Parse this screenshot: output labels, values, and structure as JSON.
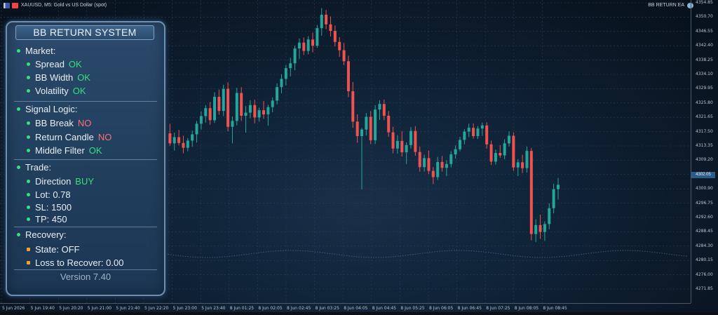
{
  "window": {
    "title": "XAUUSD, M5:  Gold vs US Dollar (spot)",
    "ea_name": "BB RETURN EA"
  },
  "panel": {
    "title": "BB RETURN SYSTEM",
    "market": {
      "label": "Market:",
      "spread_label": "Spread",
      "spread_value": "OK",
      "bbwidth_label": "BB Width",
      "bbwidth_value": "OK",
      "volatility_label": "Volatility",
      "volatility_value": "OK"
    },
    "signal": {
      "label": "Signal Logic:",
      "bbbreak_label": "BB Break",
      "bbbreak_value": "NO",
      "returncandle_label": "Return Candle",
      "returncandle_value": "NO",
      "middlefilter_label": "Middle Filter",
      "middlefilter_value": "OK"
    },
    "trade": {
      "label": "Trade:",
      "direction_label": "Direction",
      "direction_value": "BUY",
      "lot_label": "Lot:",
      "lot_value": "0.78",
      "sl_label": "SL:",
      "sl_value": "1500",
      "tp_label": "TP:",
      "tp_value": "450"
    },
    "recovery": {
      "label": "Recovery:",
      "state_label": "State:",
      "state_value": "OFF",
      "loss_label": "Loss to Recover:",
      "loss_value": "0.00"
    },
    "version": "Version 7.40"
  },
  "colors": {
    "bull": "#26a69a",
    "bear": "#ef5350",
    "ok": "#36e07a",
    "no": "#ff6f6f",
    "accent": "#2c5d86"
  },
  "chart_data": {
    "type": "candlestick",
    "symbol": "XAUUSD",
    "timeframe": "M5",
    "current_price": "4302.05",
    "y_ticks": [
      "4354.85",
      "4350.70",
      "4346.55",
      "4342.40",
      "4338.25",
      "4334.10",
      "4329.95",
      "4325.80",
      "4321.65",
      "4317.50",
      "4313.35",
      "4309.20",
      "4305.05",
      "4300.90",
      "4296.75",
      "4292.60",
      "4288.45",
      "4284.30",
      "4280.15",
      "4276.00",
      "4271.85"
    ],
    "x_ticks": [
      "5 Jun 2026",
      "5 Jun 19:40",
      "5 Jun 20:20",
      "5 Jun 21:00",
      "5 Jun 21:40",
      "5 Jun 22:20",
      "5 Jun 23:00",
      "5 Jun 23:40",
      "8 Jun 01:25",
      "8 Jun 02:05",
      "8 Jun 02:45",
      "8 Jun 03:25",
      "8 Jun 04:05",
      "8 Jun 04:45",
      "8 Jun 05:25",
      "8 Jun 06:05",
      "8 Jun 06:45",
      "8 Jun 07:25",
      "8 Jun 08:05",
      "8 Jun 08:45"
    ],
    "ohlc": [
      [
        4321.5,
        4323.1,
        4316.2,
        4317.0
      ],
      [
        4317.0,
        4319.8,
        4313.4,
        4314.1
      ],
      [
        4314.1,
        4317.2,
        4312.0,
        4315.9
      ],
      [
        4315.9,
        4318.0,
        4313.5,
        4314.2
      ],
      [
        4314.2,
        4316.3,
        4311.2,
        4312.8
      ],
      [
        4312.8,
        4315.6,
        4311.8,
        4314.9
      ],
      [
        4314.9,
        4317.8,
        4313.1,
        4316.7
      ],
      [
        4316.7,
        4320.6,
        4314.3,
        4319.8
      ],
      [
        4319.8,
        4323.4,
        4318.1,
        4322.0
      ],
      [
        4322.0,
        4325.2,
        4320.1,
        4324.3
      ],
      [
        4324.3,
        4326.1,
        4319.5,
        4320.8
      ],
      [
        4320.8,
        4328.9,
        4320.0,
        4327.6
      ],
      [
        4327.6,
        4329.7,
        4322.4,
        4323.5
      ],
      [
        4323.5,
        4331.1,
        4322.0,
        4329.9
      ],
      [
        4329.9,
        4331.8,
        4317.6,
        4318.9
      ],
      [
        4318.9,
        4321.9,
        4314.1,
        4320.6
      ],
      [
        4320.6,
        4330.2,
        4319.3,
        4328.7
      ],
      [
        4328.7,
        4330.4,
        4320.6,
        4322.1
      ],
      [
        4322.1,
        4324.9,
        4317.2,
        4323.0
      ],
      [
        4323.0,
        4326.6,
        4321.4,
        4325.2
      ],
      [
        4325.2,
        4326.8,
        4319.9,
        4321.6
      ],
      [
        4321.6,
        4324.5,
        4320.4,
        4323.7
      ],
      [
        4323.7,
        4326.4,
        4321.2,
        4322.5
      ],
      [
        4322.5,
        4325.3,
        4319.2,
        4324.6
      ],
      [
        4324.6,
        4327.4,
        4323.1,
        4326.5
      ],
      [
        4326.5,
        4331.5,
        4325.4,
        4330.4
      ],
      [
        4330.4,
        4334.2,
        4328.6,
        4332.8
      ],
      [
        4332.8,
        4336.8,
        4330.9,
        4335.9
      ],
      [
        4335.9,
        4338.9,
        4333.5,
        4337.3
      ],
      [
        4337.3,
        4342.4,
        4335.3,
        4341.6
      ],
      [
        4341.6,
        4344.5,
        4338.6,
        4343.3
      ],
      [
        4343.3,
        4344.8,
        4339.7,
        4340.9
      ],
      [
        4340.9,
        4345.2,
        4339.9,
        4344.2
      ],
      [
        4344.2,
        4346.2,
        4340.5,
        4342.4
      ],
      [
        4342.4,
        4348.4,
        4341.8,
        4347.5
      ],
      [
        4347.5,
        4353.3,
        4345.3,
        4351.4
      ],
      [
        4351.4,
        4352.8,
        4347.2,
        4348.6
      ],
      [
        4348.6,
        4350.9,
        4345.1,
        4346.7
      ],
      [
        4346.7,
        4348.3,
        4342.2,
        4343.5
      ],
      [
        4343.5,
        4344.9,
        4339.2,
        4341.1
      ],
      [
        4341.1,
        4343.2,
        4336.8,
        4337.9
      ],
      [
        4337.9,
        4339.5,
        4327.5,
        4329.2
      ],
      [
        4329.2,
        4331.9,
        4318.6,
        4320.4
      ],
      [
        4320.4,
        4322.5,
        4314.3,
        4316.2
      ],
      [
        4316.2,
        4318.6,
        4300.8,
        4318.1
      ],
      [
        4318.1,
        4322.9,
        4316.4,
        4321.8
      ],
      [
        4321.8,
        4323.5,
        4313.9,
        4315.0
      ],
      [
        4315.0,
        4325.2,
        4313.9,
        4323.9
      ],
      [
        4323.9,
        4326.6,
        4320.9,
        4325.5
      ],
      [
        4325.5,
        4326.8,
        4320.8,
        4322.1
      ],
      [
        4322.1,
        4323.5,
        4316.0,
        4317.3
      ],
      [
        4317.3,
        4318.9,
        4311.2,
        4312.6
      ],
      [
        4312.6,
        4316.5,
        4311.1,
        4314.8
      ],
      [
        4314.8,
        4317.6,
        4310.3,
        4311.5
      ],
      [
        4311.5,
        4314.4,
        4308.1,
        4313.6
      ],
      [
        4313.6,
        4318.8,
        4312.6,
        4317.7
      ],
      [
        4317.7,
        4319.1,
        4310.5,
        4311.6
      ],
      [
        4311.6,
        4313.2,
        4305.9,
        4307.2
      ],
      [
        4307.2,
        4310.8,
        4305.9,
        4309.8
      ],
      [
        4309.8,
        4312.0,
        4305.2,
        4306.1
      ],
      [
        4306.1,
        4307.2,
        4302.3,
        4304.3
      ],
      [
        4304.3,
        4310.2,
        4303.5,
        4308.7
      ],
      [
        4308.7,
        4310.4,
        4305.9,
        4307.0
      ],
      [
        4307.0,
        4309.2,
        4304.6,
        4308.1
      ],
      [
        4308.1,
        4311.8,
        4307.1,
        4310.9
      ],
      [
        4310.9,
        4313.5,
        4309.7,
        4312.4
      ],
      [
        4312.4,
        4316.0,
        4311.8,
        4315.1
      ],
      [
        4315.1,
        4318.2,
        4313.8,
        4317.5
      ],
      [
        4317.5,
        4319.8,
        4315.9,
        4318.6
      ],
      [
        4318.6,
        4319.9,
        4315.5,
        4316.2
      ],
      [
        4316.2,
        4319.1,
        4315.4,
        4318.4
      ],
      [
        4318.4,
        4320.1,
        4316.3,
        4319.3
      ],
      [
        4319.3,
        4320.2,
        4312.6,
        4313.8
      ],
      [
        4313.8,
        4314.9,
        4307.8,
        4308.8
      ],
      [
        4308.8,
        4312.3,
        4307.9,
        4311.3
      ],
      [
        4311.3,
        4313.6,
        4309.9,
        4310.6
      ],
      [
        4310.6,
        4315.3,
        4309.5,
        4314.1
      ],
      [
        4314.1,
        4317.6,
        4313.2,
        4316.3
      ],
      [
        4316.3,
        4317.3,
        4306.1,
        4307.1
      ],
      [
        4307.1,
        4309.5,
        4304.6,
        4308.6
      ],
      [
        4308.6,
        4310.8,
        4305.5,
        4306.9
      ],
      [
        4306.9,
        4313.2,
        4305.6,
        4311.9
      ],
      [
        4311.9,
        4312.8,
        4286.0,
        4287.8
      ],
      [
        4287.8,
        4292.1,
        4285.5,
        4290.4
      ],
      [
        4290.4,
        4293.4,
        4286.4,
        4288.4
      ],
      [
        4288.4,
        4291.5,
        4285.8,
        4290.7
      ],
      [
        4290.7,
        4296.7,
        4289.2,
        4295.3
      ],
      [
        4295.3,
        4302.3,
        4293.8,
        4300.8
      ],
      [
        4300.8,
        4304.1,
        4297.8,
        4302.1
      ]
    ]
  }
}
